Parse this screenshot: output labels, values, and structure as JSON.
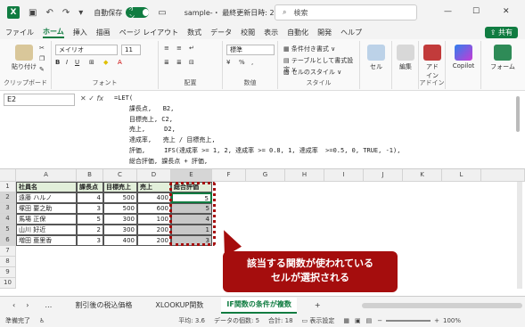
{
  "titlebar": {
    "autosave_label": "自動保存",
    "autosave_state": "オン",
    "doc_title": "sample-・ 最終更新日時: 2 時間前 ∨",
    "search_placeholder": "検索"
  },
  "menu": [
    "ファイル",
    "ホーム",
    "挿入",
    "描画",
    "ページ レイアウト",
    "数式",
    "データ",
    "校閲",
    "表示",
    "自動化",
    "開発",
    "ヘルプ"
  ],
  "share_label": "共有",
  "ribbon": {
    "clipboard": {
      "paste": "貼り付け",
      "label": "クリップボード"
    },
    "font": {
      "name": "メイリオ",
      "size": "11",
      "label": "フォント"
    },
    "align": {
      "label": "配置"
    },
    "number": {
      "format": "標準",
      "label": "数値"
    },
    "styles": {
      "cond": "条件付き書式 ∨",
      "table": "テーブルとして書式設定 ∨",
      "cellstyle": "セルのスタイル ∨",
      "label": "スタイル"
    },
    "cells": "セル",
    "editing": "編集",
    "addin": "アド\nイン",
    "addin_label": "アドイン",
    "copilot": "Copilot",
    "form": "フォーム"
  },
  "namebox": "E2",
  "fx": "fx",
  "formula_lines": [
    "=LET(",
    "    課長点,   B2,",
    "    目標売上, C2,",
    "    売上,     D2,",
    "    達成率,   売上 / 目標売上,",
    "    評価,     IFS(達成率 >= 1, 2, 達成率 >= 0.8, 1, 達成率  >=0.5, 0, TRUE, -1),",
    "    総合評価, 課長点 + 評価,"
  ],
  "columns": [
    "A",
    "B",
    "C",
    "D",
    "E",
    "F",
    "G",
    "H",
    "I",
    "J",
    "K",
    "L"
  ],
  "rows": [
    "1",
    "2",
    "3",
    "4",
    "5",
    "6",
    "7",
    "8",
    "9",
    "10"
  ],
  "table": {
    "headers": [
      "社員名",
      "課長点",
      "目標売上",
      "売上",
      "総合評価"
    ],
    "data": [
      [
        "遠藤 ハルノ",
        "4",
        "500",
        "400",
        "5"
      ],
      [
        "塚田 要之助",
        "3",
        "500",
        "600",
        "5"
      ],
      [
        "馬場 正保",
        "5",
        "300",
        "100",
        "4"
      ],
      [
        "山川 好近",
        "2",
        "300",
        "200",
        "1"
      ],
      [
        "増田 亜里香",
        "3",
        "400",
        "200",
        "3"
      ]
    ]
  },
  "callout": "該当する関数が使われている\nセルが選択される",
  "sheets": [
    "割引後の税込価格",
    "XLOOKUP関数",
    "IF関数の条件が複数"
  ],
  "status": {
    "ready": "準備完了",
    "avg": "平均: 3.6",
    "count": "データの個数: 5",
    "sum": "合計: 18",
    "display": "表示設定",
    "zoom": "100%"
  }
}
